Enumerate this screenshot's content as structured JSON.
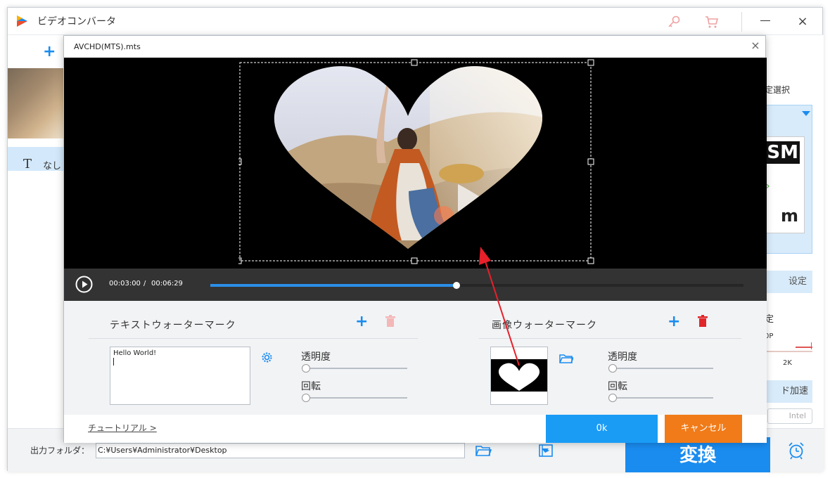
{
  "app": {
    "title": "ビデオコンバータ"
  },
  "left_panel": {
    "subtitle_label": "なし"
  },
  "right_panel": {
    "format_label_partial": "定選択",
    "format_card_top": "SM",
    "format_card_bottom": "m",
    "settings_label": "设定",
    "quality_label": "定",
    "quality_min": "0P",
    "quality_max": "2K",
    "accel_label": "ド加速",
    "intel_label": "Intel"
  },
  "bottom": {
    "output_label": "出力フォルダ：",
    "output_path": "C:¥Users¥Administrator¥Desktop",
    "convert_label": "変換"
  },
  "dialog": {
    "title": "AVCHD(MTS).mts",
    "close_label": "×",
    "player": {
      "current_time": "00:03:00",
      "separator": "/",
      "total_time": "00:06:29",
      "progress": 0.462
    },
    "text_watermark": {
      "heading": "テキストウォーターマーク",
      "text_value": "Hello World!",
      "opacity_label": "透明度",
      "rotation_label": "回転",
      "opacity_value": 0,
      "rotation_value": 0
    },
    "image_watermark": {
      "heading": "画像ウォーターマーク",
      "opacity_label": "透明度",
      "rotation_label": "回転",
      "opacity_value": 0,
      "rotation_value": 0
    },
    "footer": {
      "tutorial_label": "チュートリアル >",
      "ok_label": "0k",
      "cancel_label": "キャンセル"
    }
  },
  "colors": {
    "accent_blue": "#1a8cf0",
    "cancel_orange": "#f07b18",
    "delete_red": "#e0262a",
    "annotation_red": "#e8202a"
  },
  "icons": [
    "app-logo-icon",
    "key-icon",
    "cart-icon",
    "minimize-icon",
    "close-icon",
    "plus-icon",
    "text-t-icon",
    "play-icon",
    "gear-icon",
    "trash-icon",
    "folder-icon",
    "video-edit-icon",
    "alarm-clock-icon",
    "chevron-down-icon"
  ]
}
